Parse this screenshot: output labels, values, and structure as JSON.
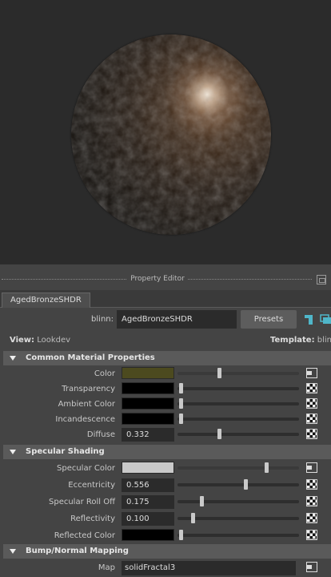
{
  "panel": {
    "title": "Property Editor"
  },
  "tab": {
    "label": "AgedBronzeSHDR"
  },
  "node": {
    "type_label": "blinn:",
    "name": "AgedBronzeSHDR",
    "presets_label": "Presets"
  },
  "view": {
    "prefix": "View:",
    "value": "Lookdev",
    "template_prefix": "Template:",
    "template_value": "blinn"
  },
  "sections": {
    "common": "Common Material Properties",
    "specular": "Specular Shading",
    "bump": "Bump/Normal Mapping"
  },
  "common_attrs": [
    {
      "label": "Color",
      "kind": "color",
      "color": "#4c4a1f",
      "level": 0.33
    },
    {
      "label": "Transparency",
      "kind": "color",
      "color": "#000000",
      "level": 0.0
    },
    {
      "label": "Ambient Color",
      "kind": "color",
      "color": "#000000",
      "level": 0.0
    },
    {
      "label": "Incandescence",
      "kind": "color",
      "color": "#000000",
      "level": 0.0
    },
    {
      "label": "Diffuse",
      "kind": "number",
      "value": "0.332",
      "level": 0.332
    }
  ],
  "specular_attrs": [
    {
      "label": "Specular Color",
      "kind": "color",
      "color": "#c9c9c9",
      "level": 0.73
    },
    {
      "label": "Eccentricity",
      "kind": "number",
      "value": "0.556",
      "level": 0.556
    },
    {
      "label": "Specular Roll Off",
      "kind": "number",
      "value": "0.175",
      "level": 0.175
    },
    {
      "label": "Reflectivity",
      "kind": "number",
      "value": "0.100",
      "level": 0.1
    },
    {
      "label": "Reflected Color",
      "kind": "color",
      "color": "#000000",
      "level": 0.0
    }
  ],
  "bump": {
    "label": "Map",
    "value": "solidFractal3"
  },
  "colors": {
    "accent_icon": "#4fb6c9",
    "panel_bg": "#444444",
    "field_bg": "#2b2b2b"
  }
}
